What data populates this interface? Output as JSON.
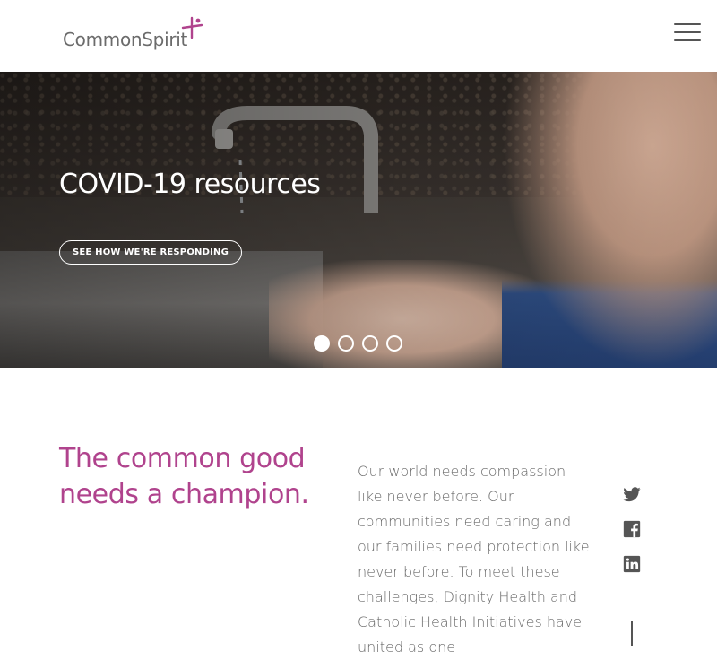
{
  "header": {
    "logo_text": "CommonSpirit",
    "menu_icon": "hamburger-menu-icon"
  },
  "hero": {
    "title": "COVID-19 resources",
    "cta_label": "SEE HOW WE'RE RESPONDING",
    "slides": [
      {
        "active": true
      },
      {
        "active": false
      },
      {
        "active": false
      },
      {
        "active": false
      }
    ]
  },
  "intro": {
    "headline": "The common good needs a champion.",
    "body": "Our world needs compassion like never before. Our communities need caring and our families need protection like never before. To meet these challenges, Dignity Health and Catholic Health Initiatives have united as one"
  },
  "social": {
    "icons": [
      "twitter-icon",
      "facebook-icon",
      "linkedin-icon"
    ]
  },
  "colors": {
    "brand_magenta": "#b0438d",
    "body_gray": "#6a6a6a",
    "icon_gray": "#555555",
    "white": "#ffffff"
  }
}
